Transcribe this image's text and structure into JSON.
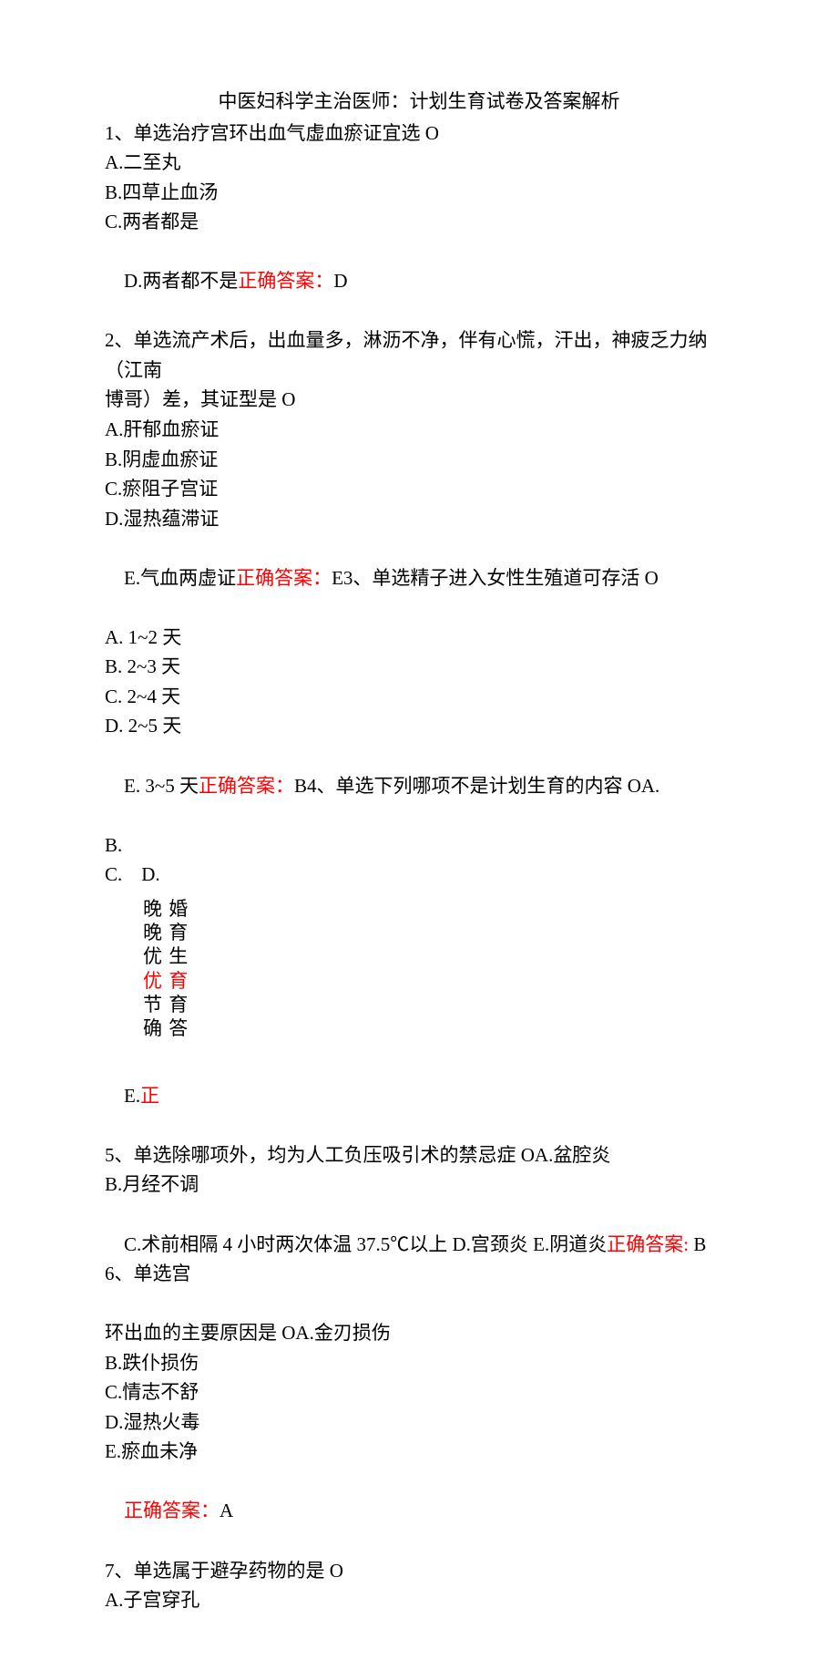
{
  "title": "中医妇科学主治医师：计划生育试卷及答案解析",
  "q1": {
    "stem": "1、单选治疗宫环出血气虚血瘀证宜选 O",
    "a": "A.二至丸",
    "b": "B.四草止血汤",
    "c": "C.两者都是",
    "d_pre": "D.两者都不是",
    "ans_label": "正确答案：",
    "ans_val": "D"
  },
  "q2": {
    "stem1": "2、单选流产术后，出血量多，淋沥不净，伴有心慌，汗出，神疲乏力纳（江南",
    "stem2": "博哥）差，其证型是 O",
    "a": "A.肝郁血瘀证",
    "b": "B.阴虚血瘀证",
    "c": "C.瘀阻子宫证",
    "d": "D.湿热蕴滞证",
    "e_pre": "E.气血两虚证",
    "ans_label": "正确答案：",
    "ans_val": "E"
  },
  "q3": {
    "stem": "3、单选精子进入女性生殖道可存活 O",
    "a": "A. 1~2 天",
    "b": "B. 2~3 天",
    "c": "C. 2~4 天",
    "d": "D. 2~5 天",
    "e_pre": "E. 3~5 天",
    "ans_label": "正确答案：",
    "ans_val": "B"
  },
  "q4": {
    "stem": "4、单选下列哪项不是计划生育的内容 OA.",
    "b": "B.",
    "cd": "C.    D.",
    "v1": "晚 婚",
    "v2": "晚 育",
    "v3": "优 生",
    "v4": "优 育",
    "v5": "节 育",
    "v6": "确 答",
    "e_pre": "E.",
    "e_red": "正"
  },
  "q5": {
    "stem": "5、单选除哪项外，均为人工负压吸引术的禁忌症 OA.盆腔炎",
    "b": "B.月经不调",
    "c_pre": "C.术前相隔 4 小时两次体温 37.5℃以上 D.宫颈炎 E.阴道炎",
    "ans_label": "正确答案:",
    "ans_val": " B"
  },
  "q6": {
    "stem": "6、单选宫",
    "stem2": "环出血的主要原因是 OA.金刃损伤",
    "b": "B.跌仆损伤",
    "c": "C.情志不舒",
    "d": "D.湿热火毒",
    "e": "E.瘀血未净",
    "ans_label": "正确答案：",
    "ans_val": "A"
  },
  "q7": {
    "stem": "7、单选属于避孕药物的是 O",
    "a": "A.子宫穿孔"
  }
}
